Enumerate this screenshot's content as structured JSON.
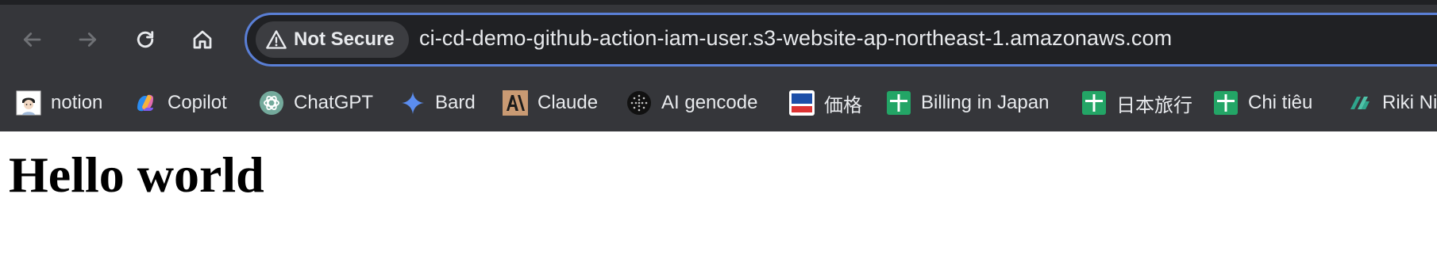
{
  "browser": {
    "omnibox": {
      "security_label": "Not Secure",
      "url": "ci-cd-demo-github-action-iam-user.s3-website-ap-northeast-1.amazonaws.com"
    },
    "bookmarks": [
      {
        "label": "notion",
        "icon": "notion-avatar-icon"
      },
      {
        "label": "Copilot",
        "icon": "copilot-icon"
      },
      {
        "label": "ChatGPT",
        "icon": "chatgpt-icon"
      },
      {
        "label": "Bard",
        "icon": "bard-icon"
      },
      {
        "label": "Claude",
        "icon": "claude-icon"
      },
      {
        "label": "AI gencode",
        "icon": "ai-gencode-icon"
      },
      {
        "label": "価格",
        "icon": "kakaku-icon"
      },
      {
        "label": "Billing in Japan",
        "icon": "google-sheets-icon"
      },
      {
        "label": "日本旅行",
        "icon": "google-sheets-icon"
      },
      {
        "label": "Chi tiêu",
        "icon": "google-sheets-icon"
      },
      {
        "label": "Riki Ni",
        "icon": "riki-icon"
      }
    ]
  },
  "page": {
    "heading": "Hello world"
  },
  "colors": {
    "toolbar_bg": "#35363a",
    "omnibox_bg": "#202124",
    "omnibox_focus_border": "#5a7fd6",
    "text_light": "#e8eaed",
    "sheets_green": "#23a566"
  }
}
